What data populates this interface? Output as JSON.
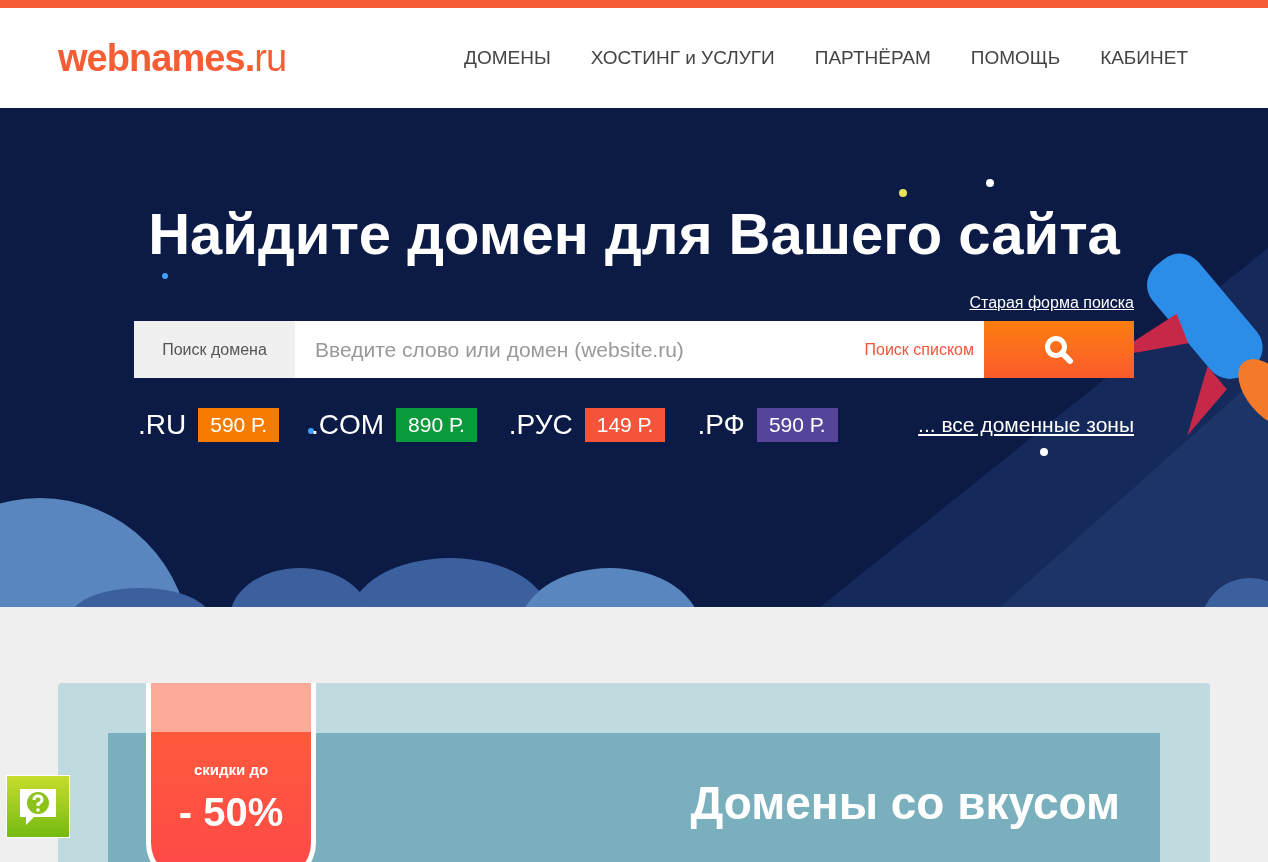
{
  "header": {
    "logo": "**webnames.**ru",
    "nav": [
      {
        "label": "ДОМЕНЫ"
      },
      {
        "label": "ХОСТИНГ и УСЛУГИ"
      },
      {
        "label": "ПАРТНЁРАМ"
      },
      {
        "label": "ПОМОЩЬ"
      },
      {
        "label": "КАБИНЕТ"
      }
    ]
  },
  "hero": {
    "title": "Найдите домен для Вашего сайта",
    "old_form_link": "Старая форма поиска",
    "search": {
      "label": "Поиск домена",
      "placeholder": "Введите слово или домен (website.ru)",
      "list_search": "Поиск списком"
    },
    "zones": [
      {
        "name": ".RU",
        "price": "590 Р.",
        "color": "#f57c00"
      },
      {
        "name": ".COM",
        "price": "890 Р.",
        "color": "#0a9a3c"
      },
      {
        "name": ".РУС",
        "price": "149 Р.",
        "color": "#f4553a"
      },
      {
        "name": ".РФ",
        "price": "590 Р.",
        "color": "#56449a"
      }
    ],
    "all_zones_link": "... все доменные зоны"
  },
  "promo": {
    "badge_top": "скидки до",
    "badge_value": "- 50%",
    "title": "Домены со вкусом"
  }
}
